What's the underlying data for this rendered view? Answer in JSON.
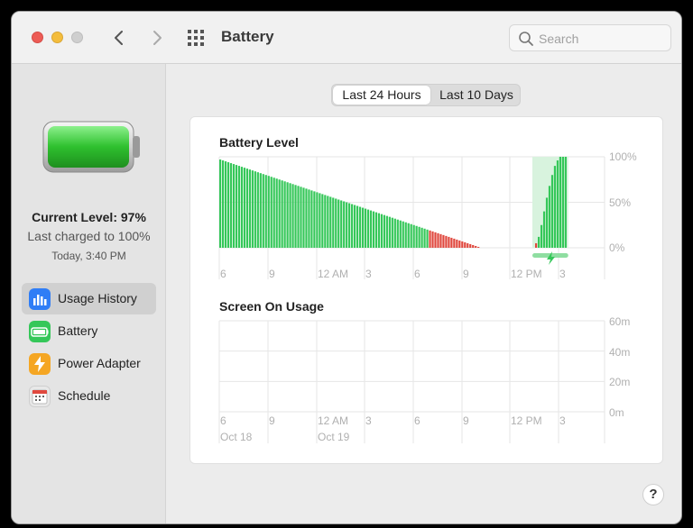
{
  "window": {
    "title": "Battery"
  },
  "search": {
    "placeholder": "Search"
  },
  "sidebar": {
    "current_level": "Current Level: 97%",
    "last_charged": "Last charged to 100%",
    "time": "Today, 3:40 PM",
    "items": [
      {
        "label": "Usage History",
        "icon": "chart-bars-icon",
        "color": "#2f7df6",
        "active": true
      },
      {
        "label": "Battery",
        "icon": "battery-icon",
        "color": "#35c759",
        "active": false
      },
      {
        "label": "Power Adapter",
        "icon": "lightning-icon",
        "color": "#f5a623",
        "active": false
      },
      {
        "label": "Schedule",
        "icon": "calendar-icon",
        "color": "#e2e2e2",
        "active": false
      }
    ]
  },
  "segments": {
    "options": [
      "Last 24 Hours",
      "Last 10 Days"
    ],
    "selected": "Last 24 Hours"
  },
  "help": {
    "label": "?"
  },
  "colors": {
    "normal": "#35c759",
    "low": "#e0483e",
    "charging_bg": "#d8f3de",
    "grid": "#e6e6e6",
    "axis_text": "#b0b0b0"
  },
  "chart_data": [
    {
      "type": "bar",
      "title": "Battery Level",
      "yticks": [
        "100%",
        "50%",
        "0%"
      ],
      "ylim": [
        0,
        100
      ],
      "xticks": [
        "6",
        "9",
        "12 AM",
        "3",
        "6",
        "9",
        "12 PM",
        "3"
      ],
      "low_threshold": 20,
      "drain_values": [
        97,
        96,
        95,
        94,
        93,
        92,
        91,
        90,
        89,
        88,
        87,
        86,
        85,
        84,
        83,
        82,
        81,
        80,
        79,
        78,
        77,
        76,
        75,
        74,
        73,
        72,
        71,
        70,
        69,
        68,
        67,
        66,
        65,
        64,
        63,
        62,
        61,
        60,
        59,
        58,
        57,
        56,
        55,
        54,
        53,
        52,
        51,
        50,
        49,
        48,
        47,
        46,
        45,
        44,
        43,
        42,
        41,
        40,
        39,
        38,
        37,
        36,
        35,
        34,
        33,
        32,
        31,
        30,
        29,
        28,
        27,
        26,
        25,
        24,
        23,
        22,
        21,
        20,
        19,
        18,
        17,
        16,
        15,
        14,
        13,
        12,
        11,
        10,
        9,
        8,
        7,
        6,
        5,
        4,
        3,
        2,
        1
      ],
      "charge_values": [
        5,
        12,
        25,
        40,
        55,
        68,
        80,
        90,
        96,
        100,
        100,
        100
      ],
      "charging_indicator": true
    },
    {
      "type": "bar",
      "title": "Screen On Usage",
      "yticks": [
        "60m",
        "40m",
        "20m",
        "0m"
      ],
      "ylim": [
        0,
        60
      ],
      "xticks": [
        "6",
        "9",
        "12 AM",
        "3",
        "6",
        "9",
        "12 PM",
        "3"
      ],
      "date_labels": [
        "Oct 18",
        "Oct 19"
      ],
      "values": []
    }
  ]
}
